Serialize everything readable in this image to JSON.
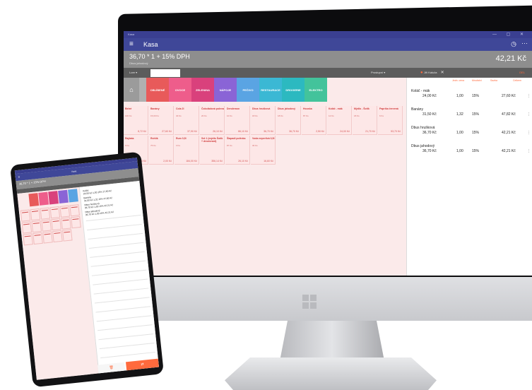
{
  "colors": {
    "appbar": "#3f4798",
    "accent": "#ff6a3d",
    "product_text": "#cf3a3a",
    "product_bg": "#fde7e7"
  },
  "monitor": {
    "app_title": "Kasa",
    "summary": "36,70 * 1 + 15% DPH",
    "summary_sub": "Dbus jahodový",
    "total": "42,21 Kč",
    "filter_select": "Lore",
    "filter_type": "Prostupní",
    "customer": "Jiří Kaluža",
    "clear_label": "DEL",
    "categories": [
      {
        "label": "OBLÍBENÉ",
        "color": "#e85a5a"
      },
      {
        "label": "OVOCE",
        "color": "#ee5d8b"
      },
      {
        "label": "ZELENINA",
        "color": "#d9417c"
      },
      {
        "label": "NÁPOJE",
        "color": "#8a64d6"
      },
      {
        "label": "PEČIVO",
        "color": "#5aa4e3"
      },
      {
        "label": "RESTAURACE",
        "color": "#3bb8d4"
      },
      {
        "label": "DROGERIE",
        "color": "#2cb9c0"
      },
      {
        "label": "ELEKTRO",
        "color": "#43c39b"
      }
    ],
    "products": [
      {
        "name": "Beleé",
        "sub": "100 Ks",
        "price": "8,72 Kč"
      },
      {
        "name": "Banány",
        "sub": "15,00 Ks",
        "price": "27,60 Kč"
      },
      {
        "name": "Cola 2l",
        "sub": "40 Ks",
        "price": "37,90 Kč"
      },
      {
        "name": "Čokoládová poleva",
        "sub": "20 Ks",
        "price": "26,10 Kč"
      },
      {
        "name": "Dendemon",
        "sub": "10 Ks",
        "price": "86,10 Kč"
      },
      {
        "name": "Dbus hrušková",
        "sub": "18 Ks",
        "price": "36,70 Kč"
      },
      {
        "name": "Dbus jahodový",
        "sub": "18 Ks",
        "price": "36,70 Kč"
      },
      {
        "name": "Houska",
        "sub": "87 Ks",
        "price": "2,50 Kč"
      },
      {
        "name": "Koláč - mák",
        "sub": "12 Ks",
        "price": "24,00 Kč"
      },
      {
        "name": "Mýdlo - Šotik",
        "sub": "18 Ks",
        "price": "21,70 Kč"
      },
      {
        "name": "Paprika červená",
        "sub": "6 Ks",
        "price": "53,70 Kč"
      },
      {
        "name": "Rajčata",
        "sub": "6 Ks",
        "price": "90,00 Kč"
      },
      {
        "name": "Rohlík",
        "sub": "75 Ks",
        "price": "2,00 Kč"
      },
      {
        "name": "Rum 0,5l",
        "sub": "3 Ks",
        "price": "184,00 Kč"
      },
      {
        "name": "Set 1 (mýdlo Šotik + deodorant)",
        "sub": "",
        "price": "356,14 Kč"
      },
      {
        "name": "Šlapadi polévka",
        "sub": "87 Ks",
        "price": "26,10 Kč"
      },
      {
        "name": "Voda neperlivá 0,5l",
        "sub": "30 Ks",
        "price": "16,60 Kč"
      }
    ],
    "order_headers": {
      "unit": "Jedn. cena",
      "qty": "Množství",
      "vat": "Sazba",
      "total": "Celkem"
    },
    "order_items": [
      {
        "name": "Koláč - mák",
        "unit": "24,00 Kč",
        "qty": "1,00",
        "vat": "15%",
        "total": "27,60 Kč"
      },
      {
        "name": "Banány",
        "unit": "31,50 Kč",
        "qty": "1,32",
        "vat": "15%",
        "total": "47,82 Kč"
      },
      {
        "name": "Dbus hrušková",
        "unit": "36,70 Kč",
        "qty": "1,00",
        "vat": "15%",
        "total": "42,21 Kč"
      },
      {
        "name": "Dbus jahodový",
        "unit": "36,70 Kč",
        "qty": "1,00",
        "vat": "15%",
        "total": "42,21 Kč"
      }
    ]
  },
  "tablet": {
    "app_title": "Kasa",
    "summary": "36,70 * 1 + 15% DPH",
    "order_items": [
      {
        "name": "Koláč",
        "line": "24,00 Kč   1,00   15%   27,60 Kč"
      },
      {
        "name": "Banány",
        "line": "31,50 Kč   1,32   15%   47,82 Kč"
      },
      {
        "name": "Dbus hrušková",
        "line": "36,70 Kč   1,00   15%   42,21 Kč"
      },
      {
        "name": "Dbus jahodový",
        "line": "36,70 Kč   1,00   15%   42,21 Kč"
      }
    ]
  }
}
